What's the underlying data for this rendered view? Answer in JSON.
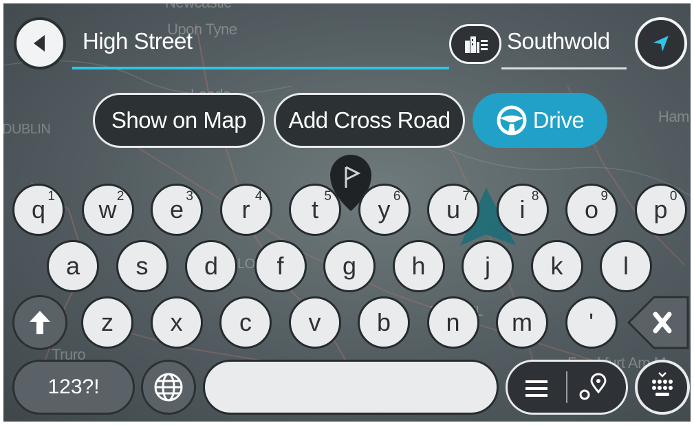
{
  "search": {
    "query": "High Street",
    "area_name": "Southwold"
  },
  "actions": {
    "show_on_map": "Show on Map",
    "add_cross_road": "Add Cross Road",
    "drive": "Drive"
  },
  "keyboard": {
    "row1": [
      {
        "ch": "q",
        "num": "1"
      },
      {
        "ch": "w",
        "num": "2"
      },
      {
        "ch": "e",
        "num": "3"
      },
      {
        "ch": "r",
        "num": "4"
      },
      {
        "ch": "t",
        "num": "5"
      },
      {
        "ch": "y",
        "num": "6"
      },
      {
        "ch": "u",
        "num": "7"
      },
      {
        "ch": "i",
        "num": "8"
      },
      {
        "ch": "o",
        "num": "9"
      },
      {
        "ch": "p",
        "num": "0"
      }
    ],
    "row2": [
      "a",
      "s",
      "d",
      "f",
      "g",
      "h",
      "j",
      "k",
      "l"
    ],
    "row3": [
      "z",
      "x",
      "c",
      "v",
      "b",
      "n",
      "m",
      "'"
    ],
    "symbols_label": "123?!"
  },
  "map_labels": {
    "city_1": "Newcastle",
    "city_2": "Upon Tyne",
    "city_3": "Leeds",
    "city_4": "DUBLIN",
    "city_5": "Ham",
    "city_6": "LONDON",
    "city_7": "BRUXEL",
    "city_8": "Truro",
    "city_9": "Frankfurt Am M"
  },
  "colors": {
    "accent": "#21a1c7",
    "underline": "#2ec5e6",
    "key_face": "#e9ebed",
    "dark_button": "#2e3236"
  }
}
